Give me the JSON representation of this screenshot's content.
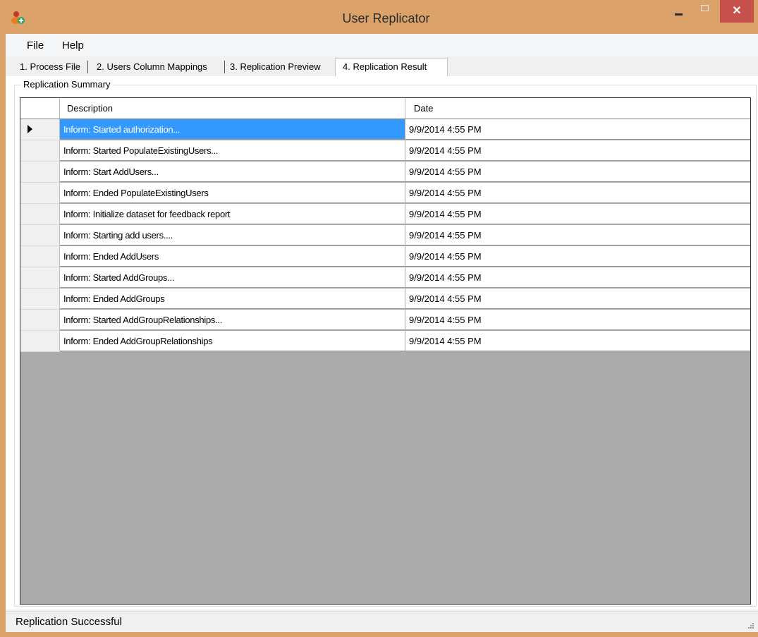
{
  "window": {
    "title": "User Replicator"
  },
  "menu": [
    {
      "label": "File"
    },
    {
      "label": "Help"
    }
  ],
  "tabs": [
    {
      "label": "1. Process File"
    },
    {
      "label": "2. Users Column Mappings"
    },
    {
      "label": "3. Replication Preview"
    },
    {
      "label": "4. Replication Result"
    }
  ],
  "active_tab": "4. Replication Result",
  "group": {
    "label": "Replication Summary"
  },
  "grid": {
    "columns": [
      "Description",
      "Date"
    ],
    "selected_row": 0,
    "rows": [
      {
        "description": "Inform: Started authorization...",
        "date": "9/9/2014 4:55 PM"
      },
      {
        "description": "Inform: Started PopulateExistingUsers...",
        "date": "9/9/2014 4:55 PM"
      },
      {
        "description": "Inform: Start AddUsers...",
        "date": "9/9/2014 4:55 PM"
      },
      {
        "description": "Inform: Ended PopulateExistingUsers",
        "date": "9/9/2014 4:55 PM"
      },
      {
        "description": "Inform: Initialize dataset for feedback report",
        "date": "9/9/2014 4:55 PM"
      },
      {
        "description": "Inform: Starting add users....",
        "date": "9/9/2014 4:55 PM"
      },
      {
        "description": "Inform: Ended AddUsers",
        "date": "9/9/2014 4:55 PM"
      },
      {
        "description": "Inform: Started AddGroups...",
        "date": "9/9/2014 4:55 PM"
      },
      {
        "description": "Inform: Ended AddGroups",
        "date": "9/9/2014 4:55 PM"
      },
      {
        "description": "Inform: Started AddGroupRelationships...",
        "date": "9/9/2014 4:55 PM"
      },
      {
        "description": "Inform: Ended AddGroupRelationships",
        "date": "9/9/2014 4:55 PM"
      }
    ]
  },
  "status": {
    "text": "Replication Successful"
  },
  "colors": {
    "titlebar": "#dba36a",
    "close_button": "#c7504c",
    "selection": "#3399ff",
    "grid_background": "#ababab"
  },
  "icons": {
    "app": "user-add-icon",
    "minimize": "minimize-icon",
    "maximize": "maximize-icon",
    "close": "close-icon",
    "grip": "resize-grip-icon"
  }
}
